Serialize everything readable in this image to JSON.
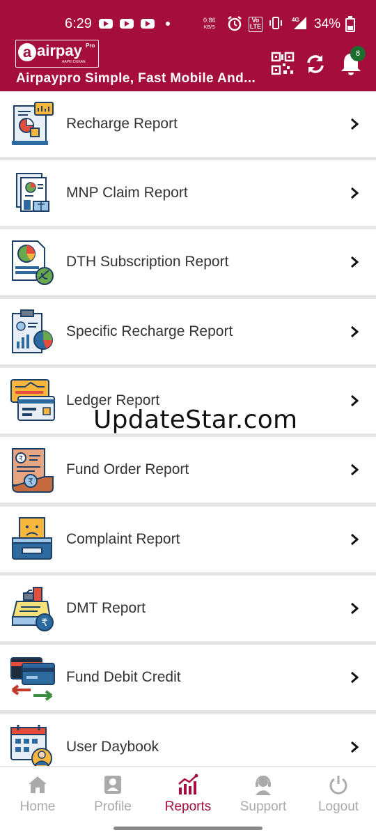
{
  "status_bar": {
    "time": "6:29",
    "net_speed_value": "0.86",
    "net_speed_unit": "KB/S",
    "volte_top": "Vo",
    "volte_bottom": "LTE",
    "network_type": "4G",
    "battery": "34%"
  },
  "header": {
    "logo_letter": "a",
    "logo_name": "airpay",
    "logo_pro": "Pro",
    "logo_tagline": "AAPKI DUKAN",
    "title": "Airpaypro  Simple, Fast Mobile And...",
    "notification_count": "8"
  },
  "menu": [
    {
      "label": "Recharge Report",
      "icon": "recharge-report-icon"
    },
    {
      "label": "MNP Claim Report",
      "icon": "mnp-claim-icon"
    },
    {
      "label": "DTH Subscription Report",
      "icon": "dth-subscription-icon"
    },
    {
      "label": "Specific Recharge Report",
      "icon": "specific-recharge-icon"
    },
    {
      "label": "Ledger Report",
      "icon": "ledger-icon"
    },
    {
      "label": "Fund Order Report",
      "icon": "fund-order-icon"
    },
    {
      "label": "Complaint Report",
      "icon": "complaint-icon"
    },
    {
      "label": "DMT Report",
      "icon": "dmt-icon"
    },
    {
      "label": "Fund Debit Credit",
      "icon": "fund-debit-credit-icon"
    },
    {
      "label": "User Daybook",
      "icon": "user-daybook-icon"
    }
  ],
  "watermark": "UpdateStar.com",
  "bottom_nav": [
    {
      "label": "Home",
      "active": false
    },
    {
      "label": "Profile",
      "active": false
    },
    {
      "label": "Reports",
      "active": true
    },
    {
      "label": "Support",
      "active": false
    },
    {
      "label": "Logout",
      "active": false
    }
  ],
  "colors": {
    "brand": "#a50d3c",
    "active_nav": "#a50d3c",
    "inactive_nav": "#aaaaaa",
    "badge": "#1b6e2f",
    "separator": "#e6e6e6"
  }
}
